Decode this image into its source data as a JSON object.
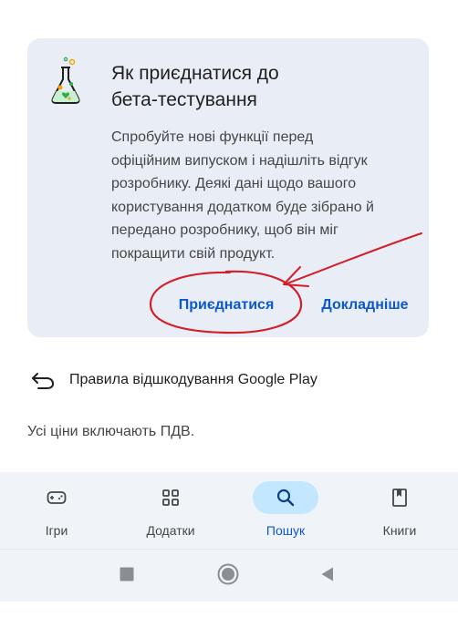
{
  "beta": {
    "title_line1": "Як приєднатися до",
    "title_line2": "бета-тестування",
    "body_lines": [
      "Спробуйте нові функції перед",
      "офіційним випуском і надішліть відгук",
      "розробнику. Деякі дані щодо вашого",
      "користування додатком буде зібрано й",
      "передано розробнику, щоб він міг",
      "покращити свій продукт."
    ],
    "join_label": "Приєднатися",
    "more_label": "Докладніше"
  },
  "refund": {
    "label": "Правила відшкодування Google Play",
    "icon": "undo-arrow-icon"
  },
  "vat": {
    "text": "Усі ціни включають ПДВ."
  },
  "nav": {
    "items": [
      {
        "label": "Ігри",
        "icon": "gamepad-icon",
        "active": false
      },
      {
        "label": "Додатки",
        "icon": "apps-grid-icon",
        "active": false
      },
      {
        "label": "Пошук",
        "icon": "search-icon",
        "active": true
      },
      {
        "label": "Книги",
        "icon": "book-icon",
        "active": false
      }
    ]
  },
  "system_nav": {
    "buttons": [
      "recents-square-icon",
      "home-circle-icon",
      "back-triangle-icon"
    ]
  },
  "colors": {
    "accent": "#0b57d0",
    "card_bg": "#e9eef6",
    "nav_bg": "#f0f4f9",
    "active_pill": "#c2e7ff",
    "annotation_red": "#d21f2a"
  }
}
